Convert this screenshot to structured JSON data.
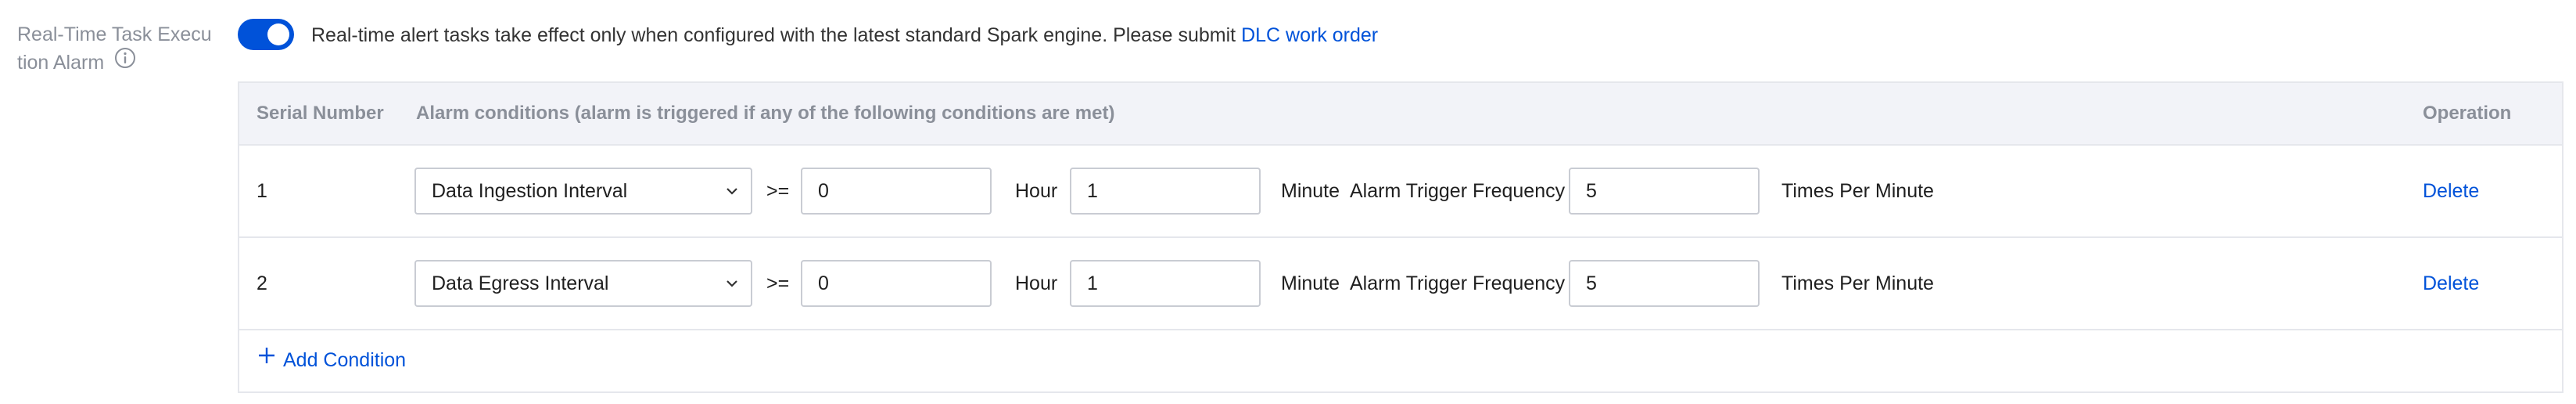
{
  "field": {
    "label": "Real-Time Task Execu tion Alarm",
    "info_icon": "info-circle-icon",
    "toggle_on": true
  },
  "notice": {
    "text": "Real-time alert tasks take effect only when configured with the latest standard Spark engine. Please submit",
    "link": "DLC work order"
  },
  "table": {
    "headers": {
      "serial": "Serial Number",
      "conditions": "Alarm conditions (alarm is triggered if any of the following conditions are met)",
      "operation": "Operation"
    },
    "rows": [
      {
        "serial": "1",
        "metric": "Data Ingestion Interval",
        "operator": ">=",
        "hours": "0",
        "hour_unit": "Hour",
        "minutes": "1",
        "minute_unit": "Minute",
        "frequency_label": "Alarm Trigger Frequency",
        "frequency": "5",
        "frequency_unit": "Times Per Minute",
        "action": "Delete"
      },
      {
        "serial": "2",
        "metric": "Data Egress Interval",
        "operator": ">=",
        "hours": "0",
        "hour_unit": "Hour",
        "minutes": "1",
        "minute_unit": "Minute",
        "frequency_label": "Alarm Trigger Frequency",
        "frequency": "5",
        "frequency_unit": "Times Per Minute",
        "action": "Delete"
      }
    ],
    "add_label": "Add Condition"
  },
  "colors": {
    "accent": "#0052d9",
    "header_bg": "#f2f3f8",
    "border": "#e5e7ec",
    "muted_text": "#8a8f99"
  }
}
